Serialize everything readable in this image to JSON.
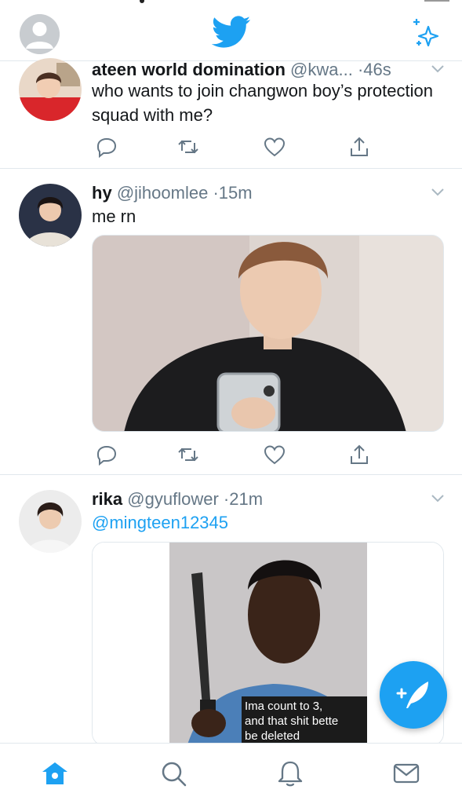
{
  "header": {
    "profile_icon": "profile-avatar-placeholder",
    "logo_icon": "twitter-bird-icon",
    "sparkle_icon": "sparkle-icon"
  },
  "colors": {
    "accent": "#1da1f2",
    "text": "#14171a",
    "muted": "#657786",
    "divider": "#e1e8ed"
  },
  "tweets": [
    {
      "name": "ateen world domination",
      "handle": "@kwa...",
      "time": "·46s",
      "text": "who wants to join changwon boy’s protection squad with me?"
    },
    {
      "name": "hy",
      "handle": "@jihoomlee",
      "time": "·15m",
      "text": "me rn"
    },
    {
      "name": "rika",
      "handle": "@gyuflower",
      "time": "·21m",
      "mention": "@mingteen12345",
      "media_caption_lines": [
        "Ima count to 3,",
        "and that shit bette",
        "be deleted"
      ]
    }
  ],
  "tabs": [
    "home-icon",
    "search-icon",
    "notifications-bell-icon",
    "messages-envelope-icon"
  ],
  "compose_icon": "compose-tweet-icon"
}
